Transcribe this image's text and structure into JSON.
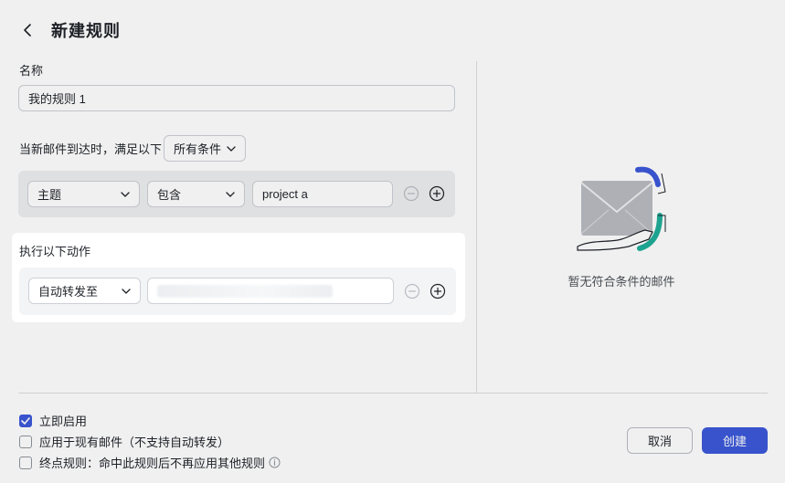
{
  "header": {
    "title": "新建规则"
  },
  "name_section": {
    "label": "名称",
    "value": "我的规则 1"
  },
  "trigger": {
    "prefix": "当新邮件到达时，满足以下",
    "match_select": "所有条件"
  },
  "condition": {
    "field": "主题",
    "operator": "包含",
    "value": "project a"
  },
  "action_section": {
    "label": "执行以下动作",
    "action_select": "自动转发至",
    "target_value": ""
  },
  "empty_state": {
    "text": "暂无符合条件的邮件"
  },
  "options": [
    {
      "label": "立即启用",
      "checked": true
    },
    {
      "label": "应用于现有邮件（不支持自动转发）",
      "checked": false
    },
    {
      "label": "终点规则：命中此规则后不再应用其他规则",
      "checked": false
    }
  ],
  "buttons": {
    "cancel": "取消",
    "create": "创建"
  },
  "colors": {
    "primary": "#3c59d9",
    "accent_green": "#1fae9a"
  }
}
